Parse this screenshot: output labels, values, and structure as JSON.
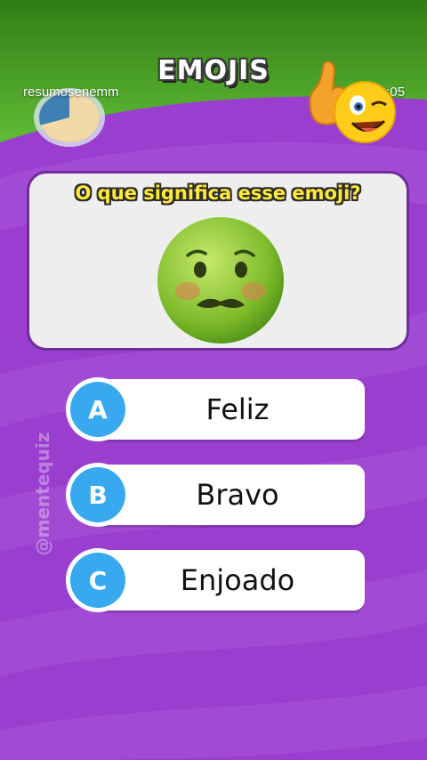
{
  "header": {
    "title": "EMOJIS",
    "username": "resumosenemm",
    "time": "0:05"
  },
  "timer": {
    "remaining_fraction": 0.7
  },
  "question": {
    "text": "O que significa esse emoji?",
    "emoji_icon": "nauseated-face-icon"
  },
  "options": [
    {
      "letter": "A",
      "label": "Feliz"
    },
    {
      "letter": "B",
      "label": "Bravo"
    },
    {
      "letter": "C",
      "label": "Enjoado"
    }
  ],
  "watermark": "@mentequiz",
  "colors": {
    "top_green": "#4caf2e",
    "purple": "#9b3fd0",
    "option_circle": "#38a9ef",
    "question_yellow": "#ffe93a"
  }
}
